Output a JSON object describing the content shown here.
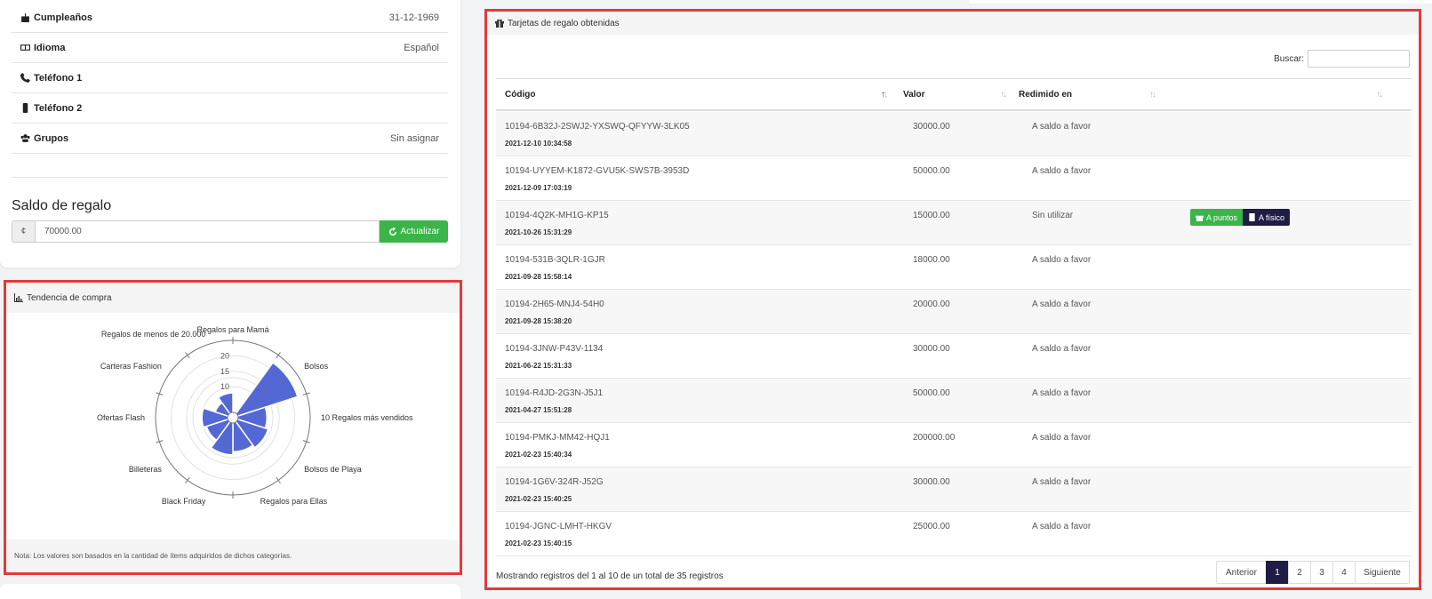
{
  "profile": {
    "rows": [
      {
        "label": "Cumpleaños",
        "value": "31-12-1969",
        "icon": "birthday-cake-icon"
      },
      {
        "label": "Idioma",
        "value": "Español",
        "icon": "language-icon"
      },
      {
        "label": "Teléfono 1",
        "value": "",
        "icon": "phone-icon"
      },
      {
        "label": "Teléfono 2",
        "value": "",
        "icon": "mobile-icon"
      },
      {
        "label": "Grupos",
        "value": "Sin asignar",
        "icon": "users-icon"
      }
    ],
    "saldo_title": "Saldo de regalo",
    "saldo_prefix": "¢",
    "saldo_value": "70000.00",
    "update_button": "Actualizar"
  },
  "trend": {
    "header": "Tendencia de compra",
    "note": "Nota: Los valores son basados en la cantidad de ítems adquiridos de dichos categorías."
  },
  "chart_data": {
    "type": "polarArea",
    "categories": [
      "Regalos para Mamá",
      "Bolsos",
      "10 Regalos más vendidos",
      "Bolsos de Playa",
      "Regalos para Ellas",
      "Black Friday",
      "Billeteras",
      "Ofertas Flash",
      "Carteras Fashion",
      "Regalos de menos de 20.000"
    ],
    "values": [
      0,
      22,
      11,
      12,
      11,
      12,
      9,
      10,
      6,
      8
    ],
    "rticks": [
      10,
      15,
      20
    ],
    "rmax": 25,
    "color": "#5468d4"
  },
  "cards": {
    "header": "Tarjetas de regalo obtenidas",
    "search_label": "Buscar:",
    "columns": [
      "Código",
      "Valor",
      "Redimido en",
      ""
    ],
    "rows": [
      {
        "code": "10194-6B32J-2SWJ2-YXSWQ-QFYYW-3LK05",
        "date": "2021-12-10 10:34:58",
        "valor": "30000.00",
        "redimido": "A saldo a favor"
      },
      {
        "code": "10194-UYYEM-K1872-GVU5K-SWS7B-3953D",
        "date": "2021-12-09 17:03:19",
        "valor": "50000.00",
        "redimido": "A saldo a favor"
      },
      {
        "code": "10194-4Q2K-MH1G-KP15",
        "date": "2021-10-26 15:31:29",
        "valor": "15000.00",
        "redimido": "Sin utilizar"
      },
      {
        "code": "10194-531B-3QLR-1GJR",
        "date": "2021-09-28 15:58:14",
        "valor": "18000.00",
        "redimido": "A saldo a favor"
      },
      {
        "code": "10194-2H65-MNJ4-54H0",
        "date": "2021-09-28 15:38:20",
        "valor": "20000.00",
        "redimido": "A saldo a favor"
      },
      {
        "code": "10194-3JNW-P43V-1134",
        "date": "2021-06-22 15:31:33",
        "valor": "30000.00",
        "redimido": "A saldo a favor"
      },
      {
        "code": "10194-R4JD-2G3N-J5J1",
        "date": "2021-04-27 15:51:28",
        "valor": "50000.00",
        "redimido": "A saldo a favor"
      },
      {
        "code": "10194-PMKJ-MM42-HQJ1",
        "date": "2021-02-23 15:40:34",
        "valor": "200000.00",
        "redimido": "A saldo a favor"
      },
      {
        "code": "10194-1G6V-324R-J52G",
        "date": "2021-02-23 15:40:25",
        "valor": "30000.00",
        "redimido": "A saldo a favor"
      },
      {
        "code": "10194-JGNC-LMHT-HKGV",
        "date": "2021-02-23 15:40:15",
        "valor": "25000.00",
        "redimido": "A saldo a favor"
      }
    ],
    "actions": {
      "puntos": "A puntos",
      "fisico": "A físico"
    },
    "info": "Mostrando registros del 1 al 10 de un total de 35 registros",
    "pager": {
      "prev": "Anterior",
      "pages": [
        "1",
        "2",
        "3",
        "4"
      ],
      "next": "Siguiente",
      "active": "1"
    }
  }
}
